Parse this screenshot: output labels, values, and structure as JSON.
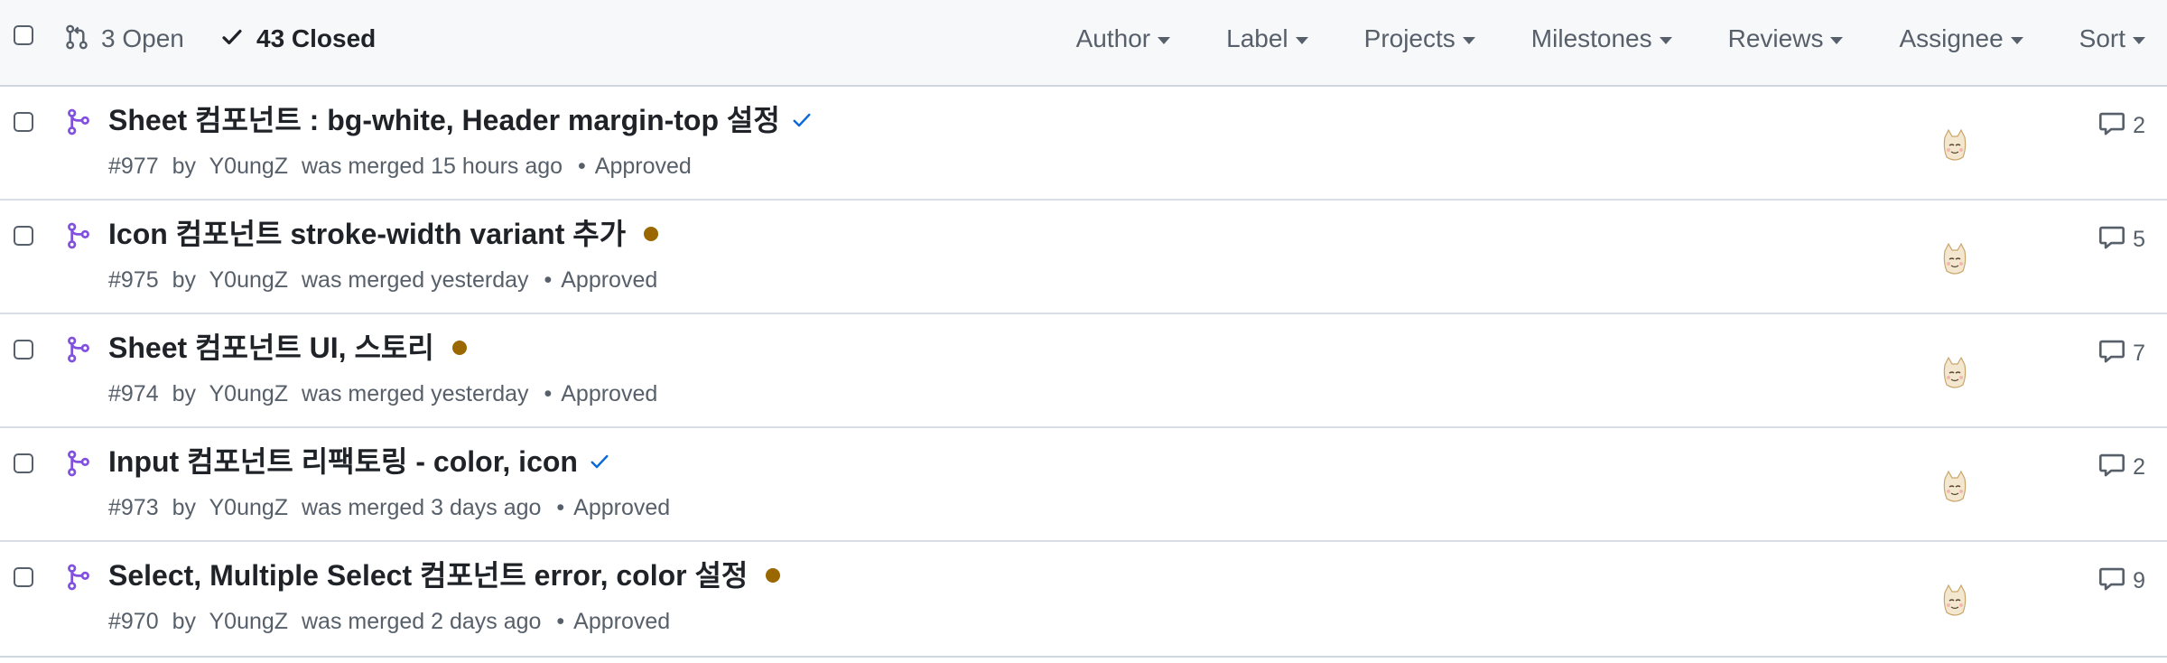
{
  "header": {
    "open_label": "3 Open",
    "closed_label": "43 Closed",
    "filters": [
      "Author",
      "Label",
      "Projects",
      "Milestones",
      "Reviews",
      "Assignee",
      "Sort"
    ]
  },
  "colors": {
    "merged_purple": "#8250df",
    "pending_dot": "#9a6700",
    "check_blue": "#0969da"
  },
  "pulls": [
    {
      "title": "Sheet 컴포넌트 : bg-white, Header margin-top 설정",
      "status_icon": "check-icon",
      "number": "#977",
      "by": "by",
      "author": "Y0ungZ",
      "merged_text": "was merged 15 hours ago",
      "review": "Approved",
      "comments": "2"
    },
    {
      "title": "Icon 컴포넌트 stroke-width variant 추가",
      "status_icon": "pending-dot-icon",
      "number": "#975",
      "by": "by",
      "author": "Y0ungZ",
      "merged_text": "was merged yesterday",
      "review": "Approved",
      "comments": "5"
    },
    {
      "title": "Sheet 컴포넌트 UI, 스토리",
      "status_icon": "pending-dot-icon",
      "number": "#974",
      "by": "by",
      "author": "Y0ungZ",
      "merged_text": "was merged yesterday",
      "review": "Approved",
      "comments": "7"
    },
    {
      "title": "Input 컴포넌트 리팩토링 - color, icon",
      "status_icon": "check-icon",
      "number": "#973",
      "by": "by",
      "author": "Y0ungZ",
      "merged_text": "was merged 3 days ago",
      "review": "Approved",
      "comments": "2"
    },
    {
      "title": "Select, Multiple Select 컴포넌트 error, color 설정",
      "status_icon": "pending-dot-icon",
      "number": "#970",
      "by": "by",
      "author": "Y0ungZ",
      "merged_text": "was merged 2 days ago",
      "review": "Approved",
      "comments": "9"
    }
  ]
}
